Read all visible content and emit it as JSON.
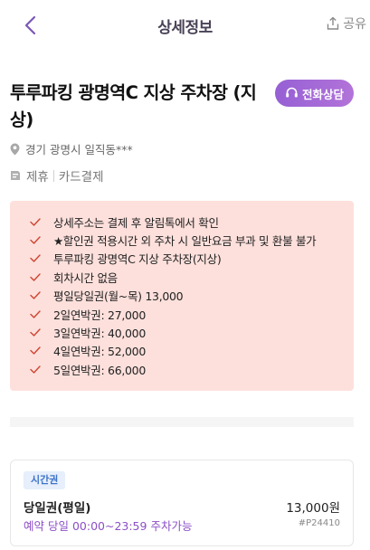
{
  "header": {
    "title": "상세정보",
    "share_label": "공유"
  },
  "lot": {
    "name": "투루파킹 광명역C 지상 주차장 (지상)",
    "call_label": "전화상담",
    "address": "경기 광명시 일직동***",
    "tags": [
      "제휴",
      "카드결제"
    ]
  },
  "notice": {
    "items": [
      "상세주소는 결제 후 알림톡에서 확인",
      "★할인권 적용시간 외 주차 시 일반요금 부과 및 환불 불가",
      "투루파킹 광명역C 지상 주차장(지상)",
      "회차시간 없음",
      "평일당일권(월~목) 13,000",
      "2일연박권: 27,000",
      "3일연박권: 40,000",
      "4일연박권: 52,000",
      "5일연박권: 66,000"
    ]
  },
  "ticket": {
    "badge": "시간권",
    "name": "당일권(평일)",
    "price": "13,000원",
    "time": "예약 당일 00:00~23:59 주차가능",
    "code": "#P24410"
  },
  "colors": {
    "accent": "#9660d4",
    "notice_bg": "#fde0dc",
    "check": "#d0442f",
    "badge_text": "#3f74c9"
  }
}
